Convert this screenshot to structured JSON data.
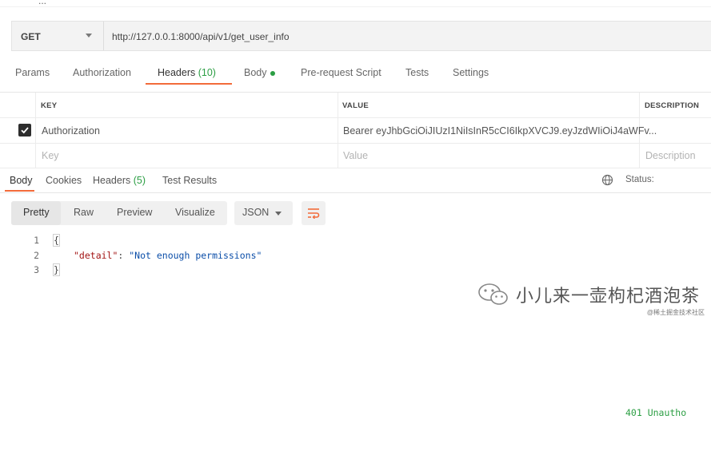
{
  "top_fragment": "...",
  "request": {
    "method": "GET",
    "url": "http://127.0.0.1:8000/api/v1/get_user_info"
  },
  "request_tabs": [
    {
      "label": "Params"
    },
    {
      "label": "Authorization"
    },
    {
      "label": "Headers",
      "count": "(10)",
      "active": true
    },
    {
      "label": "Body",
      "has_dot": true
    },
    {
      "label": "Pre-request Script"
    },
    {
      "label": "Tests"
    },
    {
      "label": "Settings"
    }
  ],
  "headers_table": {
    "columns": [
      "KEY",
      "VALUE",
      "DESCRIPTION"
    ],
    "rows": [
      {
        "checked": true,
        "key": "Authorization",
        "value": "Bearer eyJhbGciOiJIUzI1NiIsInR5cCI6IkpXVCJ9.eyJzdWIiOiJ4aWFv..."
      }
    ],
    "placeholders": {
      "key": "Key",
      "value": "Value",
      "description": "Description"
    }
  },
  "response_tabs": [
    {
      "label": "Body",
      "active": true
    },
    {
      "label": "Cookies"
    },
    {
      "label": "Headers",
      "count": "(5)"
    },
    {
      "label": "Test Results"
    }
  ],
  "status": {
    "label": "Status:",
    "value": "401 Unautho"
  },
  "view_modes": [
    "Pretty",
    "Raw",
    "Preview",
    "Visualize"
  ],
  "format": "JSON",
  "code_lines": {
    "n1": "1",
    "n2": "2",
    "n3": "3",
    "open": "{",
    "key": "\"detail\"",
    "colon": ": ",
    "value": "\"Not enough permissions\"",
    "close": "}"
  },
  "watermark": {
    "text": "小儿来一壶枸杞酒泡茶",
    "sub": "@稀土掘金技术社区"
  },
  "colors": {
    "accent": "#f26b3a",
    "success": "#2b9e43"
  },
  "icons": [
    "checkbox-icon",
    "globe-icon",
    "wrap-lines-icon",
    "chevron-down-icon",
    "wechat-icon"
  ]
}
